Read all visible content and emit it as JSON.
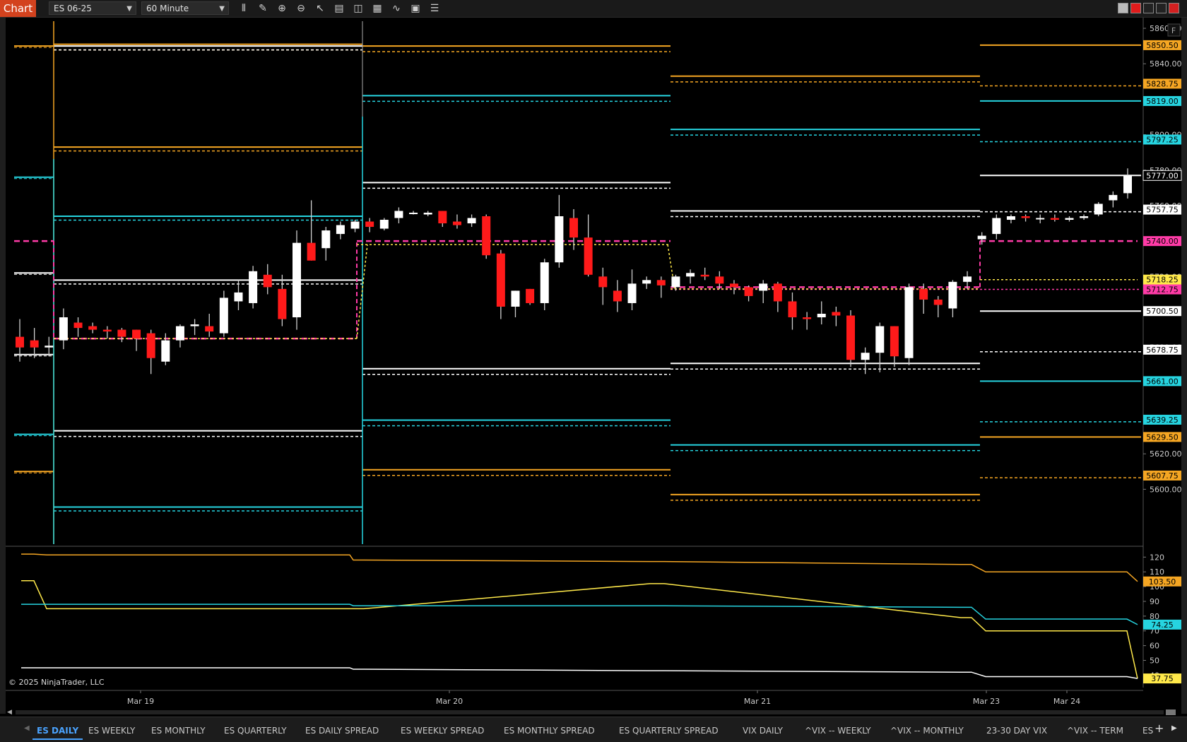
{
  "toolbar": {
    "app_tab": "Chart",
    "instrument": "ES 06-25",
    "interval": "60 Minute",
    "icons": [
      "bar-type-icon",
      "draw-tool-icon",
      "zoom-in-icon",
      "zoom-out-icon",
      "pointer-icon",
      "properties-icon",
      "template-icon",
      "data-box-icon",
      "strategy-icon",
      "indicator-icon",
      "list-icon"
    ]
  },
  "colors": {
    "background": "#000000",
    "up_candle": "#ffffff",
    "down_candle": "#ff1a1a",
    "orange": "#f5a623",
    "cyan": "#26d4e0",
    "white_level": "#ffffff",
    "magenta": "#ff3ba7",
    "yellow": "#ffe94a",
    "badge_magenta": "#ff3ba7"
  },
  "price_axis": {
    "ticks": [
      "5860.00",
      "5840.00",
      "5820.00",
      "5800.00",
      "5780.00",
      "5760.00",
      "5740.00",
      "5720.00",
      "5700.00",
      "5680.00",
      "5660.00",
      "5640.00",
      "5620.00",
      "5600.00"
    ],
    "range": [
      5587,
      5866
    ]
  },
  "level_badges": [
    {
      "label": "5850.50",
      "price": 5850.5,
      "color": "orange"
    },
    {
      "label": "5828.75",
      "price": 5828.75,
      "color": "orange"
    },
    {
      "label": "5819.00",
      "price": 5819.0,
      "color": "cyan"
    },
    {
      "label": "5797.25",
      "price": 5797.25,
      "color": "cyan"
    },
    {
      "label": "5777.00",
      "price": 5777.0,
      "color": "white_outline"
    },
    {
      "label": "5757.75",
      "price": 5757.75,
      "color": "white"
    },
    {
      "label": "5740.00",
      "price": 5740.0,
      "color": "magenta"
    },
    {
      "label": "5718.25",
      "price": 5718.25,
      "color": "yellow"
    },
    {
      "label": "5712.75",
      "price": 5712.75,
      "color": "magenta"
    },
    {
      "label": "5700.50",
      "price": 5700.5,
      "color": "white"
    },
    {
      "label": "5678.75",
      "price": 5678.75,
      "color": "white"
    },
    {
      "label": "5661.00",
      "price": 5661.0,
      "color": "cyan"
    },
    {
      "label": "5639.25",
      "price": 5639.25,
      "color": "cyan"
    },
    {
      "label": "5629.50",
      "price": 5629.5,
      "color": "orange"
    },
    {
      "label": "5607.75",
      "price": 5607.75,
      "color": "orange"
    }
  ],
  "sessions": [
    {
      "levels": {
        "o1": 5850,
        "o2": 5791,
        "c1": 5752,
        "w1": 5774,
        "w2": 5660,
        "w3": 5675,
        "w4": 5635,
        "c2": 5634,
        "c3": 5594,
        "o3": 5609,
        "o4": 5588
      },
      "mag": [
        5740,
        5685
      ],
      "yel": 5685,
      "start": "x0"
    },
    {
      "levels": {
        "o1": 5846,
        "c1": 5821,
        "w1": 5772,
        "w2": 5667,
        "c2": 5638,
        "o3": 5611
      },
      "mag": [
        5740,
        5738
      ],
      "yel": 5740
    },
    {
      "levels": {
        "o1": 5833,
        "c1": 5802,
        "w1": 5757,
        "w2": 5671,
        "c2": 5625,
        "o3": 5597
      },
      "mag": [
        5723,
        5739
      ],
      "yel": 5724
    },
    {
      "levels": {
        "o1": 5850.5,
        "o1d": 5828.75,
        "c1": 5819,
        "c1d": 5797.25,
        "w1": 5777,
        "w1d": 5757.75,
        "w2": 5700.5,
        "w2d": 5678.75,
        "c2": 5661,
        "c2d": 5639.25,
        "o3": 5629.5,
        "o3d": 5607.75
      },
      "mag": [
        5740,
        5712.75
      ],
      "yel": 5718.25
    }
  ],
  "date_axis": [
    "Mar 19",
    "Mar 20",
    "Mar 21",
    "Mar 23",
    "Mar 24"
  ],
  "copyright": "© 2025 NinjaTrader, LLC",
  "lower_panel": {
    "ticks": [
      "120",
      "110",
      "100",
      "90",
      "80",
      "70",
      "60",
      "50",
      "40"
    ],
    "range": [
      33,
      124
    ],
    "badges": [
      {
        "label": "103.50",
        "value": 103.5,
        "color": "orange"
      },
      {
        "label": "74.25",
        "value": 74.25,
        "color": "cyan"
      },
      {
        "label": "37.75",
        "value": 37.75,
        "color": "yellow"
      }
    ]
  },
  "panel_tag": "F",
  "tabs": [
    "ES DAILY",
    "ES WEEKLY",
    "ES MONTHLY",
    "ES QUARTERLY",
    "ES DAILY SPREAD",
    "ES WEEKLY SPREAD",
    "ES MONTHLY SPREAD",
    "ES QUARTERLY SPREAD",
    "VIX DAILY",
    "^VIX -- WEEKLY",
    "^VIX -- MONTHLY",
    "23-30 DAY VIX",
    "^VIX -- TERM",
    "ES"
  ],
  "active_tab": "ES DAILY",
  "chart_data": {
    "type": "candlestick",
    "instrument": "ES 06-25",
    "interval": "60 Minute",
    "candles": [
      {
        "o": 5686,
        "h": 5696,
        "l": 5672,
        "c": 5680
      },
      {
        "o": 5684,
        "h": 5691,
        "l": 5674,
        "c": 5680
      },
      {
        "o": 5680,
        "h": 5686,
        "l": 5675,
        "c": 5681
      },
      {
        "o": 5684,
        "h": 5702,
        "l": 5679,
        "c": 5697
      },
      {
        "o": 5694,
        "h": 5697,
        "l": 5686,
        "c": 5691
      },
      {
        "o": 5692,
        "h": 5694,
        "l": 5688,
        "c": 5690
      },
      {
        "o": 5690,
        "h": 5692,
        "l": 5685,
        "c": 5689
      },
      {
        "o": 5690,
        "h": 5691,
        "l": 5683,
        "c": 5686
      },
      {
        "o": 5690,
        "h": 5687,
        "l": 5678,
        "c": 5685
      },
      {
        "o": 5688,
        "h": 5690,
        "l": 5665,
        "c": 5674
      },
      {
        "o": 5672,
        "h": 5688,
        "l": 5670,
        "c": 5684
      },
      {
        "o": 5684,
        "h": 5693,
        "l": 5680,
        "c": 5692
      },
      {
        "o": 5692,
        "h": 5696,
        "l": 5687,
        "c": 5693
      },
      {
        "o": 5692,
        "h": 5699,
        "l": 5686,
        "c": 5689
      },
      {
        "o": 5688,
        "h": 5712,
        "l": 5686,
        "c": 5708
      },
      {
        "o": 5706,
        "h": 5718,
        "l": 5701,
        "c": 5711
      },
      {
        "o": 5705,
        "h": 5726,
        "l": 5702,
        "c": 5723
      },
      {
        "o": 5721,
        "h": 5727,
        "l": 5710,
        "c": 5714
      },
      {
        "o": 5713,
        "h": 5721,
        "l": 5692,
        "c": 5696
      },
      {
        "o": 5697,
        "h": 5746,
        "l": 5690,
        "c": 5739
      },
      {
        "o": 5739,
        "h": 5763,
        "l": 5734,
        "c": 5729
      },
      {
        "o": 5736,
        "h": 5748,
        "l": 5729,
        "c": 5746
      },
      {
        "o": 5744,
        "h": 5751,
        "l": 5741,
        "c": 5749
      },
      {
        "o": 5747,
        "h": 5752,
        "l": 5745,
        "c": 5751
      },
      {
        "o": 5751,
        "h": 5753,
        "l": 5745,
        "c": 5748
      },
      {
        "o": 5747,
        "h": 5753,
        "l": 5746,
        "c": 5752
      },
      {
        "o": 5753,
        "h": 5759,
        "l": 5750,
        "c": 5757
      },
      {
        "o": 5756,
        "h": 5757,
        "l": 5755,
        "c": 5756
      },
      {
        "o": 5755,
        "h": 5757,
        "l": 5754,
        "c": 5756
      },
      {
        "o": 5757,
        "h": 5757,
        "l": 5748,
        "c": 5750
      },
      {
        "o": 5751,
        "h": 5755,
        "l": 5747,
        "c": 5749
      },
      {
        "o": 5750,
        "h": 5755,
        "l": 5748,
        "c": 5753
      },
      {
        "o": 5754,
        "h": 5755,
        "l": 5730,
        "c": 5732
      },
      {
        "o": 5733,
        "h": 5735,
        "l": 5696,
        "c": 5703
      },
      {
        "o": 5703,
        "h": 5712,
        "l": 5697,
        "c": 5712
      },
      {
        "o": 5713,
        "h": 5713,
        "l": 5704,
        "c": 5705
      },
      {
        "o": 5705,
        "h": 5730,
        "l": 5701,
        "c": 5728
      },
      {
        "o": 5728,
        "h": 5766,
        "l": 5725,
        "c": 5754
      },
      {
        "o": 5753,
        "h": 5758,
        "l": 5735,
        "c": 5742
      },
      {
        "o": 5742,
        "h": 5755,
        "l": 5720,
        "c": 5721
      },
      {
        "o": 5720,
        "h": 5725,
        "l": 5704,
        "c": 5714
      },
      {
        "o": 5712,
        "h": 5718,
        "l": 5700,
        "c": 5706
      },
      {
        "o": 5705,
        "h": 5724,
        "l": 5701,
        "c": 5716
      },
      {
        "o": 5716,
        "h": 5720,
        "l": 5713,
        "c": 5718
      },
      {
        "o": 5718,
        "h": 5720,
        "l": 5708,
        "c": 5715
      },
      {
        "o": 5714,
        "h": 5721,
        "l": 5712,
        "c": 5720
      },
      {
        "o": 5720,
        "h": 5724,
        "l": 5716,
        "c": 5722
      },
      {
        "o": 5721,
        "h": 5725,
        "l": 5718,
        "c": 5720
      },
      {
        "o": 5720,
        "h": 5723,
        "l": 5713,
        "c": 5716
      },
      {
        "o": 5716,
        "h": 5718,
        "l": 5710,
        "c": 5714
      },
      {
        "o": 5714,
        "h": 5715,
        "l": 5706,
        "c": 5709
      },
      {
        "o": 5712,
        "h": 5718,
        "l": 5705,
        "c": 5716
      },
      {
        "o": 5716,
        "h": 5717,
        "l": 5700,
        "c": 5706
      },
      {
        "o": 5706,
        "h": 5711,
        "l": 5690,
        "c": 5697
      },
      {
        "o": 5697,
        "h": 5700,
        "l": 5690,
        "c": 5696
      },
      {
        "o": 5697,
        "h": 5706,
        "l": 5693,
        "c": 5699
      },
      {
        "o": 5700,
        "h": 5703,
        "l": 5692,
        "c": 5698
      },
      {
        "o": 5698,
        "h": 5701,
        "l": 5669,
        "c": 5673
      },
      {
        "o": 5673,
        "h": 5680,
        "l": 5665,
        "c": 5677
      },
      {
        "o": 5677,
        "h": 5694,
        "l": 5666,
        "c": 5692
      },
      {
        "o": 5692,
        "h": 5692,
        "l": 5669,
        "c": 5675
      },
      {
        "o": 5674,
        "h": 5716,
        "l": 5670,
        "c": 5714
      },
      {
        "o": 5713,
        "h": 5716,
        "l": 5699,
        "c": 5707
      },
      {
        "o": 5707,
        "h": 5709,
        "l": 5697,
        "c": 5704
      },
      {
        "o": 5702,
        "h": 5718,
        "l": 5697,
        "c": 5717
      },
      {
        "o": 5717,
        "h": 5723,
        "l": 5713,
        "c": 5720
      },
      {
        "o": 5741,
        "h": 5745,
        "l": 5738,
        "c": 5743
      },
      {
        "o": 5744,
        "h": 5755,
        "l": 5741,
        "c": 5753
      },
      {
        "o": 5752,
        "h": 5755,
        "l": 5750,
        "c": 5754
      },
      {
        "o": 5754,
        "h": 5755,
        "l": 5751,
        "c": 5753
      },
      {
        "o": 5753,
        "h": 5755,
        "l": 5750,
        "c": 5753
      },
      {
        "o": 5753,
        "h": 5755,
        "l": 5751,
        "c": 5752
      },
      {
        "o": 5752,
        "h": 5754,
        "l": 5751,
        "c": 5753
      },
      {
        "o": 5753,
        "h": 5755,
        "l": 5752,
        "c": 5754
      },
      {
        "o": 5755,
        "h": 5762,
        "l": 5754,
        "c": 5761
      },
      {
        "o": 5763,
        "h": 5768,
        "l": 5759,
        "c": 5766
      },
      {
        "o": 5767,
        "h": 5781,
        "l": 5764,
        "c": 5777
      }
    ],
    "lower_series": [
      {
        "color": "orange",
        "values": [
          122,
          122,
          121.5,
          121.5,
          118,
          118,
          117,
          117,
          115,
          115,
          110,
          110,
          110,
          103.5
        ]
      },
      {
        "color": "yellow",
        "values": [
          104,
          104,
          85,
          85,
          85,
          85,
          102,
          102,
          79,
          79,
          70,
          70,
          70,
          37.75
        ]
      },
      {
        "color": "cyan",
        "values": [
          88,
          88,
          88,
          88,
          87,
          87,
          87,
          87,
          86,
          86,
          78,
          78,
          78,
          74.25
        ]
      },
      {
        "color": "white",
        "values": [
          45,
          45,
          45,
          45,
          44,
          44,
          43,
          43,
          42,
          42,
          39,
          39,
          39,
          37.75
        ]
      }
    ]
  }
}
